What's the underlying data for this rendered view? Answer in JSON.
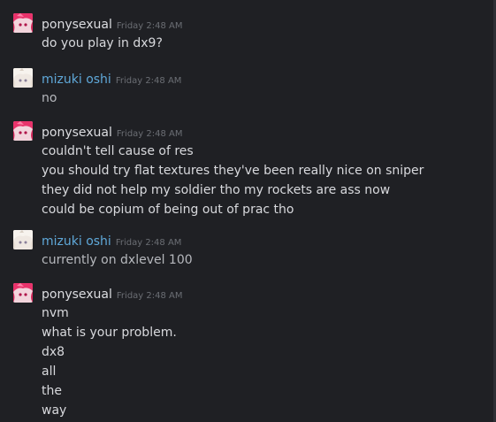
{
  "messages": [
    {
      "username": "ponysexual",
      "avatar_icon": "pink-anime-avatar-icon",
      "timestamp": "Friday 2:48 AM",
      "lines": [
        "do you play in dx9?"
      ]
    },
    {
      "username": "mizuki oshi",
      "avatar_icon": "white-hair-anime-avatar-icon",
      "timestamp": "Friday 2:48 AM",
      "lines": [
        "no"
      ]
    },
    {
      "username": "ponysexual",
      "avatar_icon": "pink-anime-avatar-icon",
      "timestamp": "Friday 2:48 AM",
      "lines": [
        "couldn't tell cause of res",
        "you should try flat textures they've been really nice on sniper",
        "they did not help my soldier tho my rockets are ass now",
        "could be copium of being out of prac tho"
      ]
    },
    {
      "username": "mizuki oshi",
      "avatar_icon": "white-hair-anime-avatar-icon",
      "timestamp": "Friday 2:48 AM",
      "lines": [
        "currently on dxlevel 100"
      ]
    },
    {
      "username": "ponysexual",
      "avatar_icon": "pink-anime-avatar-icon",
      "timestamp": "Friday 2:48 AM",
      "lines": [
        "nvm",
        "what is your problem.",
        "dx8",
        "all",
        "the",
        "way"
      ]
    }
  ],
  "colors": {
    "background": "#1f2024",
    "username_default": "#dcdde1",
    "username_blue": "#5fa8d9",
    "timestamp": "#6b6e74",
    "text": "#d8d9dd"
  }
}
